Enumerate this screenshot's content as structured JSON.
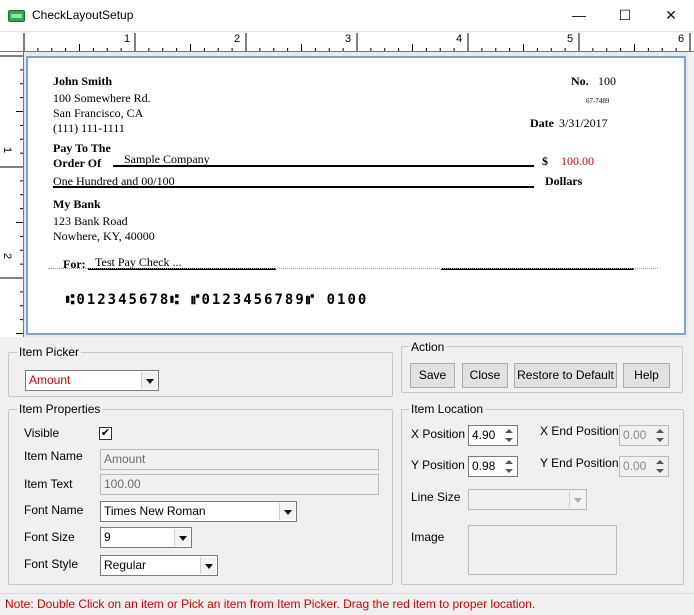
{
  "window": {
    "title": "CheckLayoutSetup",
    "minimize": "—",
    "maximize": "☐",
    "close": "✕"
  },
  "ruler": {
    "horizontal": [
      "1",
      "2",
      "3",
      "4",
      "5",
      "6"
    ],
    "vertical": [
      "1",
      "2"
    ]
  },
  "check": {
    "payer_name": "John Smith",
    "payer_address1": "100 Somewhere Rd.",
    "payer_address2": "San Francisco, CA",
    "payer_phone": "(111) 111-1111",
    "no_label": "No.",
    "no_value": "100",
    "routing_fraction": "67-7489",
    "date_label": "Date",
    "date_value": "3/31/2017",
    "pay_to_label1": "Pay To The",
    "pay_to_label2": "Order Of",
    "payee": "Sample Company",
    "currency_symbol": "$",
    "amount": "100.00",
    "amount_words": "One Hundred  and 00/100",
    "dollars_label": "Dollars",
    "bank_name": "My Bank",
    "bank_address1": "123 Bank Road",
    "bank_address2": "Nowhere, KY, 40000",
    "for_label": "For:",
    "memo": "Test Pay Check ...",
    "micr": "⑆012345678⑆ ⑈0123456789⑈  0100"
  },
  "item_picker": {
    "label": "Item Picker",
    "selected": "Amount"
  },
  "action": {
    "label": "Action",
    "save": "Save",
    "close": "Close",
    "restore": "Restore to Default",
    "help": "Help"
  },
  "item_properties": {
    "label": "Item Properties",
    "visible_label": "Visible",
    "visible_check": "✔",
    "item_name_label": "Item Name",
    "item_name_value": "Amount",
    "item_text_label": "Item Text",
    "item_text_value": "100.00",
    "font_name_label": "Font Name",
    "font_name_value": "Times New Roman",
    "font_size_label": "Font Size",
    "font_size_value": "9",
    "font_style_label": "Font Style",
    "font_style_value": "Regular"
  },
  "item_location": {
    "label": "Item Location",
    "x_label": "X Position",
    "x_value": "4.90",
    "y_label": "Y Position",
    "y_value": "0.98",
    "x_end_label": "X End Position",
    "x_end_value": "0.00",
    "y_end_label": "Y End Position",
    "y_end_value": "0.00",
    "line_size_label": "Line Size",
    "image_label": "Image"
  },
  "status": {
    "note": "Note: Double Click on an item or Pick an item from Item Picker. Drag the red item to proper location."
  },
  "colors": {
    "accent_red": "#d40000",
    "check_border": "#7aa2d6"
  }
}
